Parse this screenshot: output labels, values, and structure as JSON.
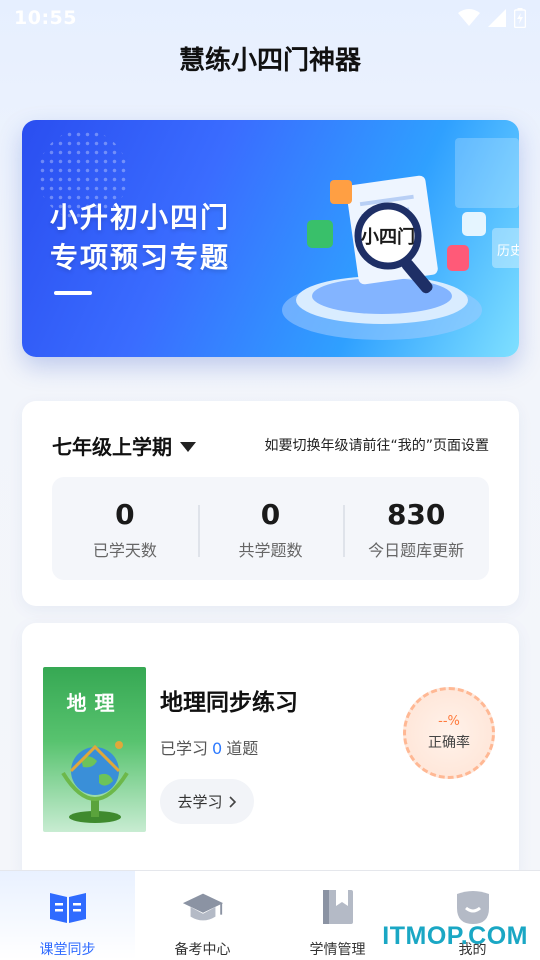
{
  "status_bar": {
    "time": "10:55"
  },
  "header": {
    "title": "慧练小四门神器"
  },
  "banner": {
    "line1": "小升初小四门",
    "line2": "专项预习专题",
    "badge_text": "小四门",
    "tag_text": "历史"
  },
  "stats": {
    "grade": "七年级上学期",
    "hint": "如要切换年级请前往“我的”页面设置",
    "items": [
      {
        "value": "0",
        "label": "已学天数"
      },
      {
        "value": "0",
        "label": "共学题数"
      },
      {
        "value": "830",
        "label": "今日题库更新"
      }
    ]
  },
  "course": {
    "cover_title": "地理",
    "title": "地理同步练习",
    "progress_prefix": "已学习",
    "progress_count": "0",
    "progress_suffix": "道题",
    "button": "去学习",
    "accuracy_value": "--%",
    "accuracy_label": "正确率"
  },
  "nav": {
    "items": [
      {
        "label": "课堂同步",
        "icon": "book-icon"
      },
      {
        "label": "备考中心",
        "icon": "graduation-cap-icon"
      },
      {
        "label": "学情管理",
        "icon": "bookmark-icon"
      },
      {
        "label": "我的",
        "icon": "profile-icon"
      }
    ]
  },
  "watermark": "ITMOP.COM",
  "colors": {
    "accent": "#2f6bff",
    "banner_start": "#2a4ef0",
    "accuracy": "#ff7a3c",
    "cover_green": "#36a853"
  }
}
